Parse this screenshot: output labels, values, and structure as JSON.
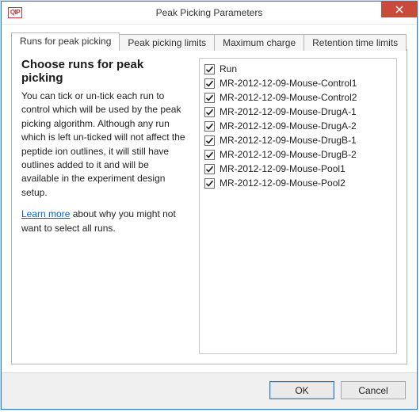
{
  "window": {
    "title": "Peak Picking Parameters",
    "app_icon_text": "QIP"
  },
  "tabs": [
    {
      "label": "Runs for peak picking",
      "active": true
    },
    {
      "label": "Peak picking limits",
      "active": false
    },
    {
      "label": "Maximum charge",
      "active": false
    },
    {
      "label": "Retention time limits",
      "active": false
    }
  ],
  "panel": {
    "heading": "Choose runs for peak picking",
    "description": "You can tick or un-tick each run to control which will be used by the peak picking algorithm. Although any run which is left un-ticked will not affect the peptide ion outlines, it will still have outlines added to it and will be available in the experiment design setup.",
    "learn_more_text": "Learn more",
    "learn_more_suffix": " about why you might not want to select all runs."
  },
  "run_list": {
    "header_label": "Run",
    "header_checked": true,
    "items": [
      {
        "label": "MR-2012-12-09-Mouse-Control1",
        "checked": true
      },
      {
        "label": "MR-2012-12-09-Mouse-Control2",
        "checked": true
      },
      {
        "label": "MR-2012-12-09-Mouse-DrugA-1",
        "checked": true
      },
      {
        "label": "MR-2012-12-09-Mouse-DrugA-2",
        "checked": true
      },
      {
        "label": "MR-2012-12-09-Mouse-DrugB-1",
        "checked": true
      },
      {
        "label": "MR-2012-12-09-Mouse-DrugB-2",
        "checked": true
      },
      {
        "label": "MR-2012-12-09-Mouse-Pool1",
        "checked": true
      },
      {
        "label": "MR-2012-12-09-Mouse-Pool2",
        "checked": true
      }
    ]
  },
  "buttons": {
    "ok": "OK",
    "cancel": "Cancel"
  }
}
